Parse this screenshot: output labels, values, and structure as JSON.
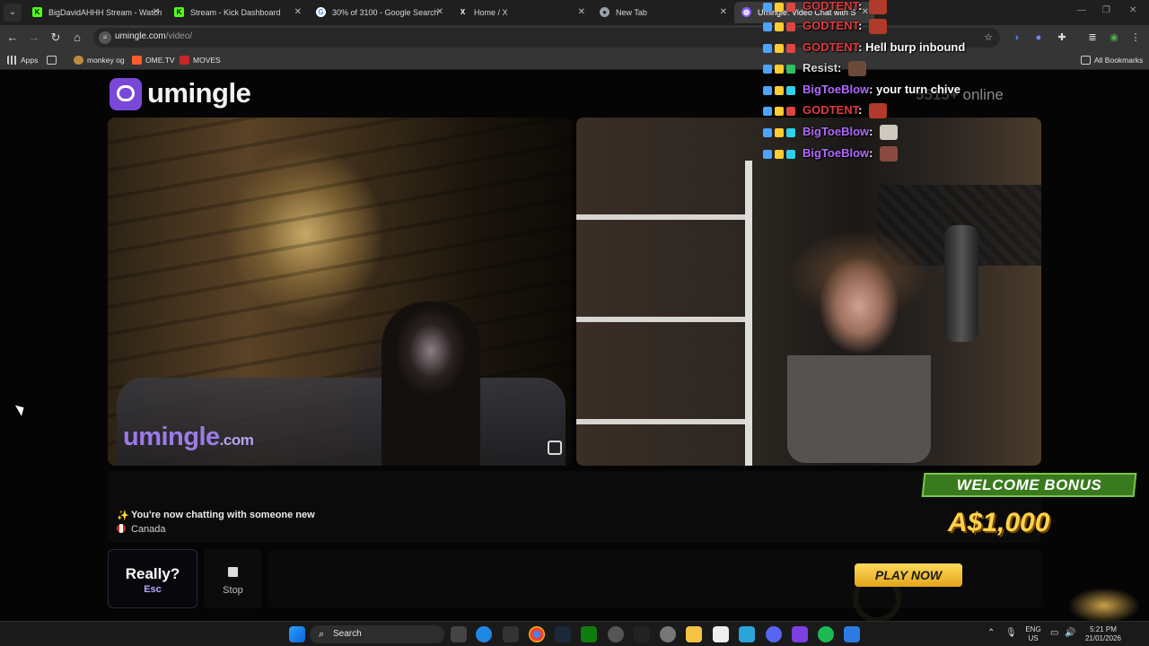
{
  "browser": {
    "tabs": [
      {
        "title": "BigDavidAHHH Stream - Watch",
        "favicon_color": "#53fc18",
        "favicon_char": "K"
      },
      {
        "title": "Stream - Kick Dashboard",
        "favicon_color": "#53fc18",
        "favicon_char": "K"
      },
      {
        "title": "30% of 3100 - Google Search",
        "favicon_color": "#ffffff",
        "favicon_char": "G"
      },
      {
        "title": "Home / X",
        "favicon_color": "#ffffff",
        "favicon_char": "X"
      },
      {
        "title": "New Tab",
        "favicon_color": "#9aa0a6",
        "favicon_char": "◉"
      },
      {
        "title": "Umingle: Video Chat with S",
        "favicon_color": "#8b5cf6",
        "favicon_char": "◍",
        "active": true
      }
    ],
    "url_host": "umingle.com",
    "url_path": "/video/",
    "bookmarks": {
      "apps": "Apps",
      "items": [
        "monkey og",
        "OME.TV",
        "MOVES"
      ],
      "all": "All Bookmarks"
    }
  },
  "site": {
    "logo": "umingle",
    "online_count": "5515+",
    "online_label": "online",
    "watermark_main": "umingle",
    "watermark_suffix": ".com"
  },
  "chat_overlay": [
    {
      "user": "GODTENT",
      "user_color": "#e0393e",
      "msg": "",
      "emote": true
    },
    {
      "user": "GODTENT",
      "user_color": "#e0393e",
      "msg": "",
      "emote": true
    },
    {
      "user": "GODTENT",
      "user_color": "#e0393e",
      "msg": "Hell burp inbound",
      "emote": false
    },
    {
      "user": "Resist",
      "user_color": "#d8d8d8",
      "msg": "",
      "emote": true
    },
    {
      "user": "BigToeBlow",
      "user_color": "#b169ff",
      "msg": "your turn chive",
      "emote": false
    },
    {
      "user": "GODTENT",
      "user_color": "#e0393e",
      "msg": "",
      "emote": true
    },
    {
      "user": "BigToeBlow",
      "user_color": "#b169ff",
      "msg": "",
      "emote": true
    },
    {
      "user": "BigToeBlow",
      "user_color": "#b169ff",
      "msg": "",
      "emote": true
    }
  ],
  "status": {
    "line1": "You're now chatting with someone new",
    "line2": "Canada"
  },
  "controls": {
    "esc_main": "Really?",
    "esc_hint": "Esc",
    "stop": "Stop"
  },
  "ad": {
    "headline": "WELCOME BONUS",
    "amount": "A$1,000",
    "cta": "PLAY NOW"
  },
  "taskbar": {
    "search": "Search",
    "lang1": "ENG",
    "lang2": "US",
    "time": "5:21 PM",
    "date": "21/01/2026"
  }
}
